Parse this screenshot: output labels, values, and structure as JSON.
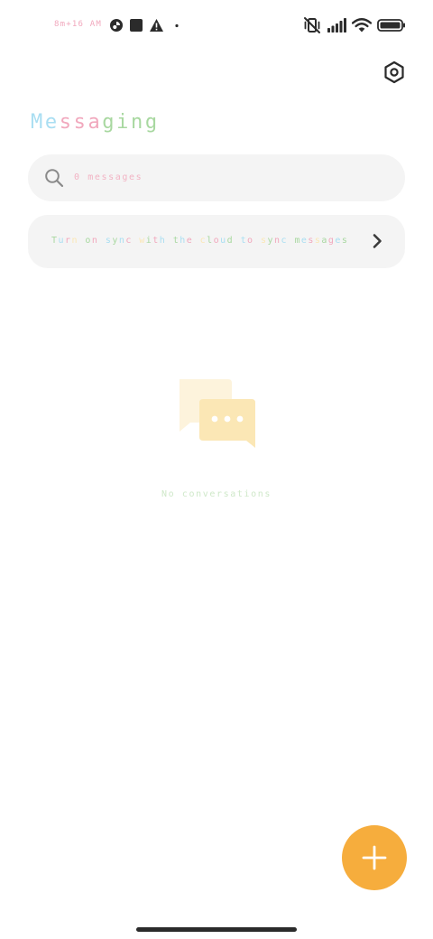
{
  "status_bar": {
    "time": "8m+16 AM",
    "left_icons": [
      "notification-app-icon",
      "stop-square-icon",
      "warning-icon",
      "more-dot-icon"
    ],
    "right_icons": [
      "vibrate-off-icon",
      "signal-icon",
      "wifi-icon",
      "battery-icon"
    ]
  },
  "header": {
    "title": "Messaging",
    "settings_icon": "settings-hexagon-icon"
  },
  "search": {
    "placeholder": "0 messages",
    "icon": "search-icon"
  },
  "sync_banner": {
    "text": "Turn on sync with the cloud to sync messages",
    "icon": "chevron-right-icon"
  },
  "empty_state": {
    "illustration": "chat-bubbles-icon",
    "text": "No conversations"
  },
  "fab": {
    "icon": "plus-icon"
  },
  "colors": {
    "accent": "#f6ad3d",
    "pastel_blue": "#a9def2",
    "pastel_pink": "#f1a8bd",
    "pastel_green": "#a8d8a0",
    "pastel_yellow": "#fbe7b5",
    "surface": "#f4f4f4",
    "icon_dark": "#2b2b2b"
  }
}
